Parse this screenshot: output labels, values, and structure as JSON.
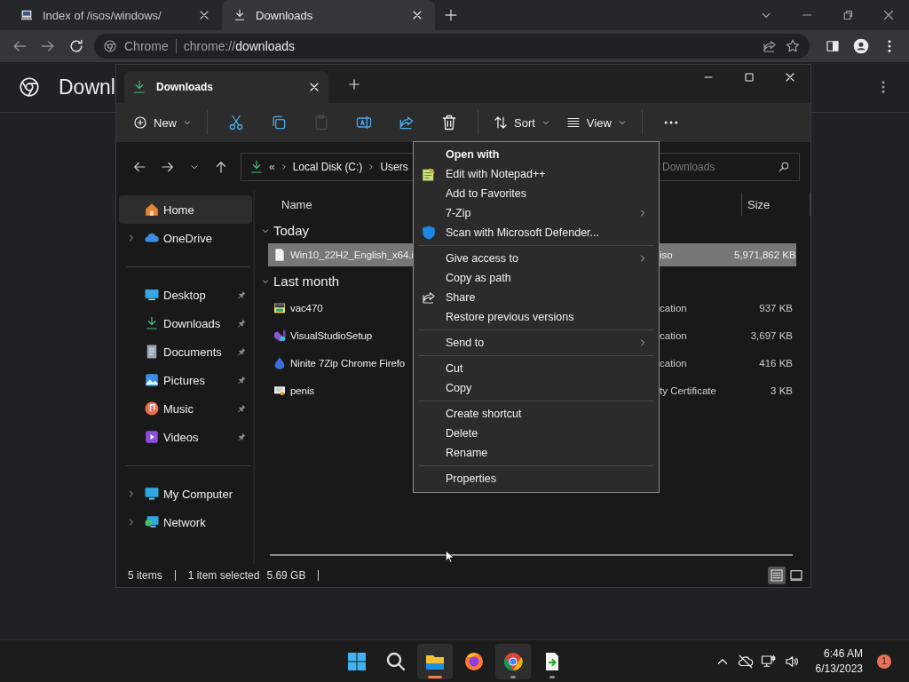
{
  "browser": {
    "tabs": [
      {
        "title": "Index of /isos/windows/",
        "kind": "server",
        "selected": false
      },
      {
        "title": "Downloads",
        "kind": "download",
        "selected": true
      }
    ],
    "address": {
      "site_label": "Chrome",
      "url_scheme": "chrome://",
      "url_rest": "downloads"
    },
    "page_title": "Downl"
  },
  "explorer": {
    "tab": {
      "title": "Downloads"
    },
    "toolbar": [
      {
        "kind": "new",
        "label": "New",
        "disabled": false
      },
      {
        "kind": "cut",
        "disabled": false
      },
      {
        "kind": "copy",
        "disabled": false
      },
      {
        "kind": "paste",
        "disabled": true
      },
      {
        "kind": "rename",
        "disabled": false
      },
      {
        "kind": "share",
        "disabled": false
      },
      {
        "kind": "delete",
        "disabled": false
      },
      {
        "kind": "sort",
        "label": "Sort",
        "disabled": false
      },
      {
        "kind": "view",
        "label": "View",
        "disabled": false
      },
      {
        "kind": "more",
        "disabled": false
      }
    ],
    "breadcrumb_overflow": "«",
    "breadcrumb": [
      "Local Disk (C:)",
      "Users"
    ],
    "search": {
      "placeholder": "Downloads"
    },
    "sidebar": [
      {
        "label": "Home",
        "kind": "home",
        "selected": true,
        "expandable": false,
        "pinned": false
      },
      {
        "label": "OneDrive",
        "kind": "cloud",
        "selected": false,
        "expandable": true,
        "pinned": false
      },
      {
        "kind": "divider"
      },
      {
        "label": "Desktop",
        "kind": "desktop",
        "selected": false,
        "expandable": false,
        "pinned": true
      },
      {
        "label": "Downloads",
        "kind": "downloads",
        "selected": false,
        "expandable": false,
        "pinned": true
      },
      {
        "label": "Documents",
        "kind": "documents",
        "selected": false,
        "expandable": false,
        "pinned": true
      },
      {
        "label": "Pictures",
        "kind": "pictures",
        "selected": false,
        "expandable": false,
        "pinned": true
      },
      {
        "label": "Music",
        "kind": "music",
        "selected": false,
        "expandable": false,
        "pinned": true
      },
      {
        "label": "Videos",
        "kind": "videos",
        "selected": false,
        "expandable": false,
        "pinned": true
      },
      {
        "kind": "divider"
      },
      {
        "label": "My Computer",
        "kind": "computer",
        "selected": false,
        "expandable": true,
        "pinned": false
      },
      {
        "label": "Network",
        "kind": "network",
        "selected": false,
        "expandable": true,
        "pinned": false
      }
    ],
    "columns": {
      "name": "Name",
      "size": "Size"
    },
    "groups": [
      {
        "label": "Today",
        "expanded": true,
        "files": [
          {
            "name": "Win10_22H2_English_x64.i",
            "type": "iso",
            "size": "5,971,862 KB",
            "kind": "blank",
            "selected": true
          }
        ]
      },
      {
        "label": "Last month",
        "expanded": true,
        "files": [
          {
            "name": "vac470",
            "type": "cation",
            "size": "937 KB",
            "kind": "installer",
            "selected": false
          },
          {
            "name": "VisualStudioSetup",
            "type": "cation",
            "size": "3,697 KB",
            "kind": "studio",
            "selected": false
          },
          {
            "name": "Ninite 7Zip Chrome Firefo",
            "type": "cation",
            "size": "416 KB",
            "kind": "drop",
            "selected": false
          },
          {
            "name": "penis",
            "type": "ty Certificate",
            "size": "3 KB",
            "kind": "certificate",
            "selected": false
          }
        ]
      }
    ],
    "status": {
      "count": "5 items",
      "selection": "1 item selected",
      "selection_size": "5.69 GB"
    },
    "views": [
      {
        "kind": "details",
        "selected": true
      },
      {
        "kind": "tiles",
        "selected": false
      }
    ]
  },
  "context_menu": [
    [
      {
        "label": "Open with",
        "default": true,
        "submenu": false
      },
      {
        "label": "Edit with Notepad++",
        "kind": "notepad",
        "default": false,
        "submenu": false
      },
      {
        "label": "Add to Favorites",
        "default": false,
        "submenu": false
      },
      {
        "label": "7-Zip",
        "default": false,
        "submenu": true
      },
      {
        "label": "Scan with Microsoft Defender...",
        "kind": "shield",
        "default": false,
        "submenu": false
      }
    ],
    [
      {
        "label": "Give access to",
        "default": false,
        "submenu": true
      },
      {
        "label": "Copy as path",
        "default": false,
        "submenu": false
      },
      {
        "label": "Share",
        "kind": "share",
        "default": false,
        "submenu": false
      },
      {
        "label": "Restore previous versions",
        "default": false,
        "submenu": false
      }
    ],
    [
      {
        "label": "Send to",
        "default": false,
        "submenu": true
      }
    ],
    [
      {
        "label": "Cut",
        "default": false,
        "submenu": false
      },
      {
        "label": "Copy",
        "default": false,
        "submenu": false
      }
    ],
    [
      {
        "label": "Create shortcut",
        "default": false,
        "submenu": false
      },
      {
        "label": "Delete",
        "default": false,
        "submenu": false
      },
      {
        "label": "Rename",
        "default": false,
        "submenu": false
      }
    ],
    [
      {
        "label": "Properties",
        "default": false,
        "submenu": false
      }
    ]
  ],
  "taskbar": {
    "apps": [
      {
        "kind": "start",
        "highlighted": false,
        "running": false,
        "focused": false
      },
      {
        "kind": "search",
        "highlighted": false,
        "running": false,
        "focused": false
      },
      {
        "kind": "explorer",
        "highlighted": true,
        "running": true,
        "focused": true
      },
      {
        "kind": "firefox",
        "highlighted": false,
        "running": false,
        "focused": false
      },
      {
        "kind": "chrome",
        "highlighted": true,
        "running": true,
        "focused": false
      },
      {
        "kind": "script",
        "highlighted": false,
        "running": true,
        "focused": false
      }
    ],
    "time": "6:46 AM",
    "date": "6/13/2023",
    "notifications": "1"
  }
}
